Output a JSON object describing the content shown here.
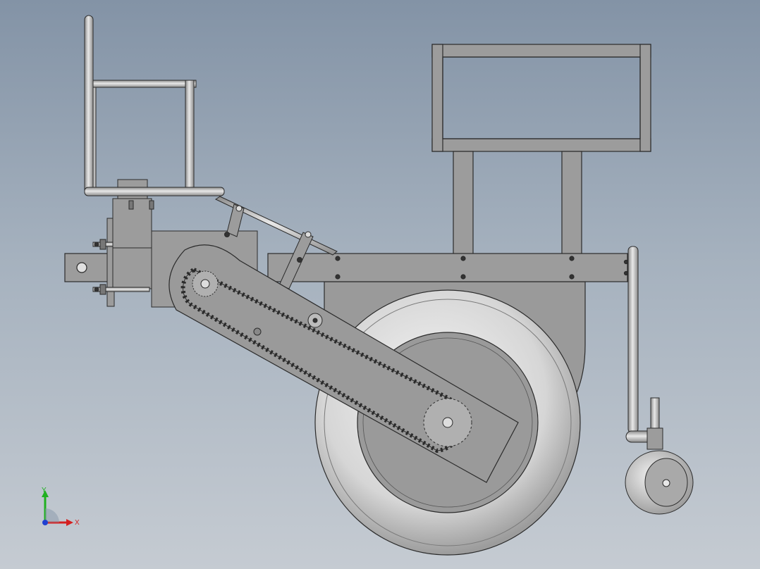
{
  "viewport": {
    "background_top": "#8393a6",
    "background_bottom": "#c5cbd2"
  },
  "model": {
    "part_color": "#9a9a9a",
    "edge_color": "#2b2b2b",
    "components": [
      "seat-backrest-frame",
      "seat-mount-bracket",
      "hitch-clamp",
      "main-frame-beam",
      "chain-drive-housing",
      "drive-chain",
      "drive-sprocket-small",
      "drive-sprocket-large",
      "press-wheel",
      "hopper-frame",
      "hopper-support-legs",
      "gauge-wheel-stand",
      "gauge-wheel",
      "lift-linkage-arm"
    ]
  },
  "triad": {
    "x_label": "X",
    "y_label": "Y",
    "x_color": "#d42020",
    "y_color": "#20b020",
    "z_color": "#2040d0"
  }
}
